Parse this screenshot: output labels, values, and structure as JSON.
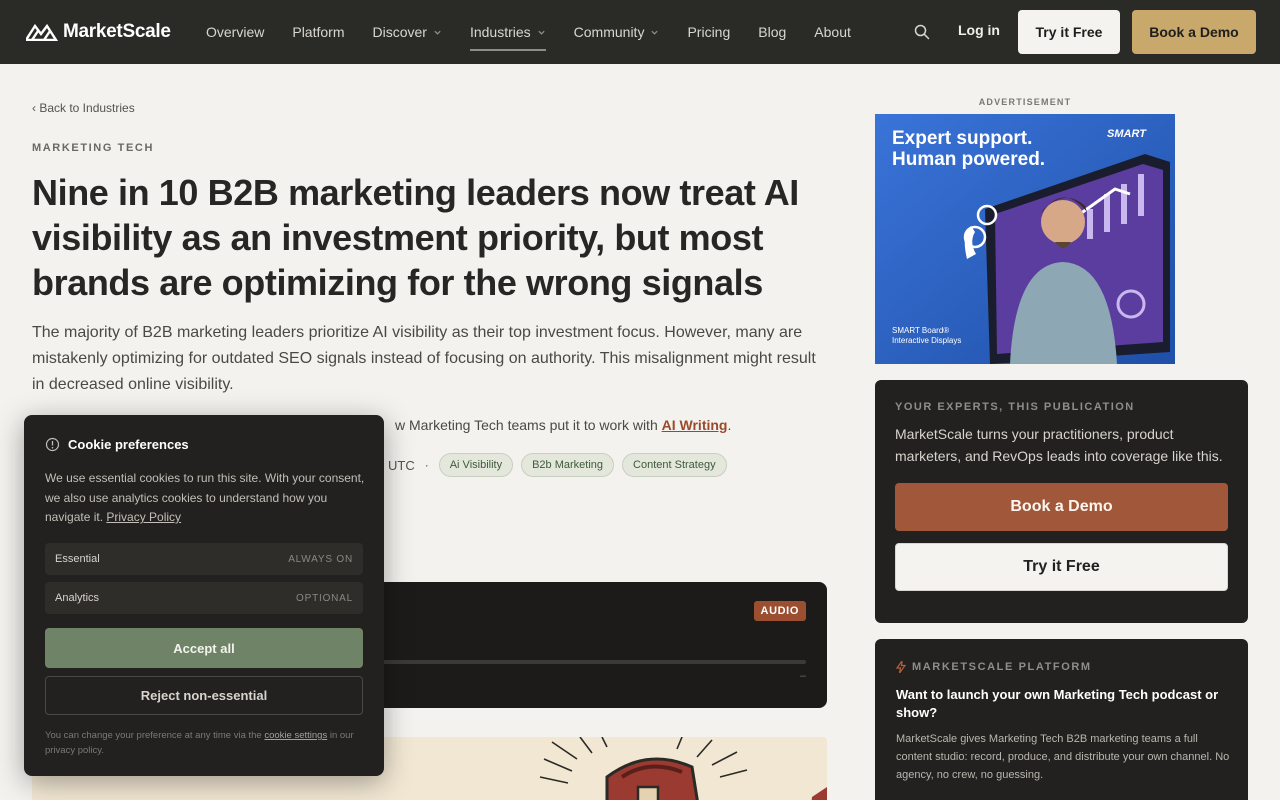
{
  "nav": {
    "logo_text": "MarketScale",
    "items": [
      {
        "label": "Overview",
        "has_menu": false
      },
      {
        "label": "Platform",
        "has_menu": false
      },
      {
        "label": "Discover",
        "has_menu": true
      },
      {
        "label": "Industries",
        "has_menu": true,
        "active": true
      },
      {
        "label": "Community",
        "has_menu": true
      },
      {
        "label": "Pricing",
        "has_menu": false
      },
      {
        "label": "Blog",
        "has_menu": false
      },
      {
        "label": "About",
        "has_menu": false
      }
    ],
    "login_label": "Log in",
    "try_label": "Try it Free",
    "demo_label": "Book a Demo"
  },
  "article": {
    "back_label": "‹ Back to Industries",
    "category": "MARKETING TECH",
    "headline": "Nine in 10 B2B marketing leaders now treat AI visibility as an investment priority, but most brands are optimizing for the wrong signals",
    "dek": "The majority of B2B marketing leaders prioritize AI visibility as their top investment focus. However, many are mistakenly optimizing for outdated SEO signals instead of focusing on authority. This misalignment might result in decreased online visibility.",
    "see_how_prefix": "w Marketing Tech teams put it to work with ",
    "see_how_link": "AI Writing",
    "see_how_suffix": ".",
    "time_fragment": "UTC",
    "meta_sep": "·",
    "tags": [
      "Ai Visibility",
      "B2b Marketing",
      "Content Strategy"
    ],
    "audio_badge": "AUDIO",
    "audio_time": "–"
  },
  "ad": {
    "label": "ADVERTISEMENT",
    "headline_line1": "Expert support.",
    "headline_line2": "Human powered.",
    "brand": "SMART",
    "foot_line1": "SMART Board®",
    "foot_line2": "Interactive Displays"
  },
  "experts": {
    "eyebrow": "YOUR EXPERTS, THIS PUBLICATION",
    "text": "MarketScale turns your practitioners, product marketers, and RevOps leads into coverage like this.",
    "demo_label": "Book a Demo",
    "try_label": "Try it Free"
  },
  "platform": {
    "eyebrow": "MARKETSCALE PLATFORM",
    "title": "Want to launch your own Marketing Tech podcast or show?",
    "body": "MarketScale gives Marketing Tech B2B marketing teams a full content studio: record, produce, and distribute your own channel. No agency, no crew, no guessing."
  },
  "cookie": {
    "title": "Cookie preferences",
    "body": "We use essential cookies to run this site. With your consent, we also use analytics cookies to understand how you navigate it. ",
    "policy_link": "Privacy Policy",
    "rows": [
      {
        "label": "Essential",
        "status": "ALWAYS ON"
      },
      {
        "label": "Analytics",
        "status": "OPTIONAL"
      }
    ],
    "accept_label": "Accept all",
    "reject_label": "Reject non-essential",
    "foot_prefix": "You can change your preference at any time via the ",
    "foot_link": "cookie settings",
    "foot_suffix": " in our privacy policy."
  },
  "colors": {
    "nav_bg": "#2a2a27",
    "page_bg": "#f4f2ee",
    "accent_rust": "#a1573a",
    "accent_gold": "#c9a86c",
    "accept_green": "#6f8467"
  }
}
